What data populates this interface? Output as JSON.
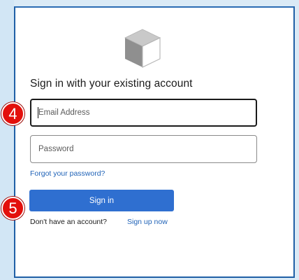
{
  "brand": {
    "logo_icon": "cube-icon",
    "accent_color": "#2f6fd0",
    "border_color": "#1f5fa6"
  },
  "form": {
    "heading": "Sign in with your existing account",
    "email_placeholder": "Email Address",
    "password_placeholder": "Password",
    "forgot_link": "Forgot your password?",
    "signin_button": "Sign in",
    "no_account_text": "Don't have an account?",
    "signup_link": "Sign up now"
  },
  "markers": {
    "step_email": "4",
    "step_signin": "5",
    "marker_color": "#e3100c"
  }
}
